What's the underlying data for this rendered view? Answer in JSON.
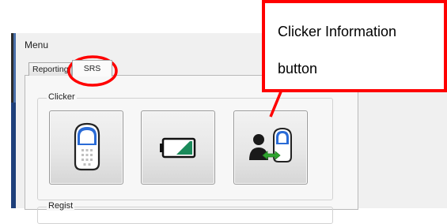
{
  "window": {
    "menu_title": "Menu"
  },
  "tabs": [
    {
      "label": "Reporting",
      "selected": false
    },
    {
      "label": "SRS",
      "selected": true
    }
  ],
  "clicker_group": {
    "label": "Clicker",
    "buttons": [
      {
        "icon": "clicker-device-icon"
      },
      {
        "icon": "battery-icon"
      },
      {
        "icon": "clicker-information-icon"
      }
    ]
  },
  "regist_group": {
    "label": "Regist"
  },
  "callout": {
    "line1": "Clicker Information",
    "line2": "button",
    "color": "#ff0000"
  },
  "colors": {
    "accent_blue": "#2a6bd6",
    "battery_green": "#1a8a5a",
    "arrow_green": "#2ea52e",
    "annotation_red": "#ff0000"
  }
}
